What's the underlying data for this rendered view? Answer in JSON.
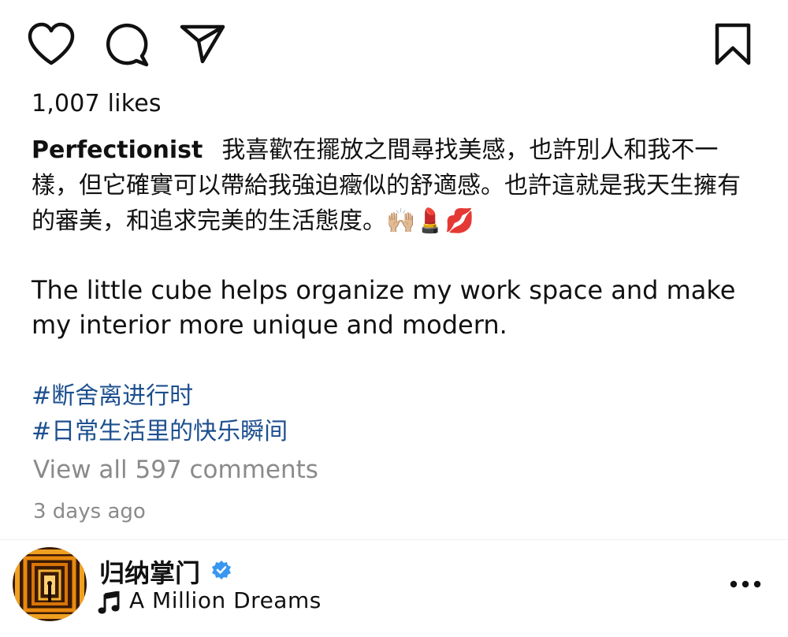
{
  "post": {
    "likes": "1,007 likes",
    "username": "Perfectionist",
    "caption_zh": "我喜歡在擺放之間尋找美感，也許別人和我不一樣，但它確實可以帶給我強迫癥似的舒適感。也許這就是我天生擁有的審美，和追求完美的生活態度。🙌🏼💄💋",
    "caption_en": "The little cube helps organize my work space and make my interior more unique and modern.",
    "hashtags": [
      "#断舍离进行时",
      "#日常生活里的快乐瞬间"
    ],
    "view_comments": "View all 597 comments",
    "posted": "3 days ago"
  },
  "account": {
    "name": "归纳掌门",
    "verified": true,
    "music": "A Million Dreams"
  },
  "icons": {
    "like": "heart-icon",
    "comment": "speech-bubble-icon",
    "share": "paper-plane-icon",
    "save": "bookmark-icon",
    "verified": "verified-badge-icon",
    "music": "music-note-icon",
    "more": "more-options-icon"
  },
  "colors": {
    "hashtag": "#1d4f8f",
    "muted": "#8a8a8a",
    "verified": "#3897f0"
  }
}
